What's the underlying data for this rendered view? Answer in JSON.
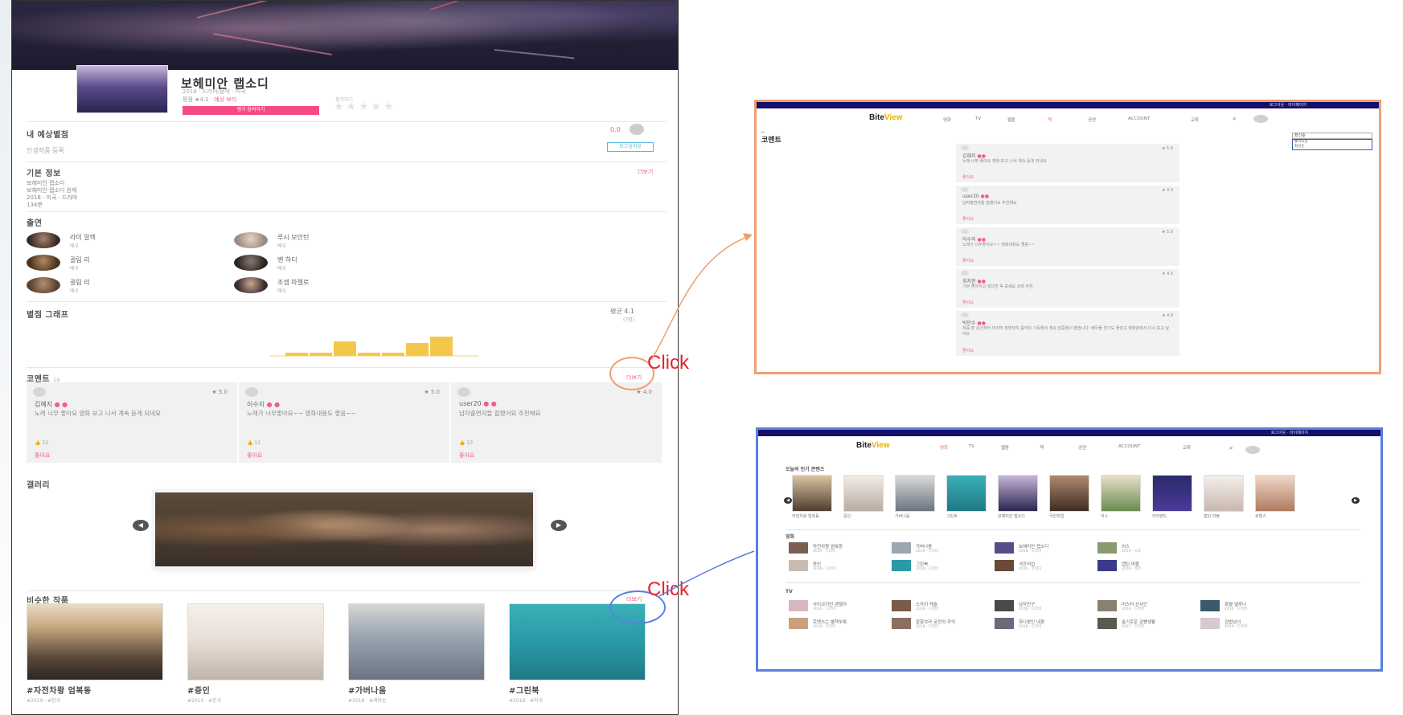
{
  "main": {
    "title": "보헤미안 랩소디",
    "subtitle": "2018 · 드라마/음악 · 미국",
    "rate_label": "평점",
    "rate_value": "★4.1",
    "rate_link": "예상 보러",
    "rate_button": "평가 참여하기",
    "stars_label": "평가하기",
    "stars": "★★★★★",
    "expect": {
      "title": "내 예상별점",
      "text": "인생작품 등록",
      "score": "0.0",
      "button": "보고싶어요"
    },
    "basic": {
      "title": "기본 정보",
      "more": "더보기",
      "lines": [
        "보헤미안 랩소디",
        "보헤미안 랩소디 원제",
        "2018 · 미국 · 드라마",
        "134분"
      ]
    },
    "cast": {
      "title": "출연",
      "people": [
        {
          "name": "라미 말렉",
          "role": "배우"
        },
        {
          "name": "루시 보인턴",
          "role": "배우"
        },
        {
          "name": "귈림 리",
          "role": "배우"
        },
        {
          "name": "벤 하디",
          "role": "배우"
        },
        {
          "name": "귈림 리",
          "role": "배우"
        },
        {
          "name": "조셉 마젤로",
          "role": "배우"
        }
      ]
    },
    "graph": {
      "title": "별점 그래프",
      "avg": "평균 4.1",
      "count": "(7명)"
    },
    "comments": {
      "title": "코멘트",
      "count": "19",
      "more": "더보기",
      "items": [
        {
          "user": "김혜지",
          "score": "5.0",
          "text": "노래 너무 좋아요 영화 보고 나서 계속 듣게 되네요",
          "likes": "12",
          "like_label": "좋아요"
        },
        {
          "user": "이수지",
          "score": "5.0",
          "text": "노래가 너무좋아요~~ 영화내용도 좋음~~",
          "likes": "11",
          "like_label": "좋아요"
        },
        {
          "user": "user20",
          "score": "4.0",
          "text": "남자출연자들 잘했어요 추천해요",
          "likes": "13",
          "like_label": "좋아요"
        }
      ]
    },
    "gallery": {
      "title": "갤러리"
    },
    "recommend": {
      "title": "비슷한 작품",
      "more": "더보기",
      "items": [
        {
          "title": "#자전차왕 엄복동",
          "sub": "#2019 · #한국"
        },
        {
          "title": "#증인",
          "sub": "#2019 · #한국"
        },
        {
          "title": "#가버나움",
          "sub": "#2018 · #레바논"
        },
        {
          "title": "#그린북",
          "sub": "#2018 · #미국"
        }
      ]
    }
  },
  "annotation": {
    "click_1": "Click",
    "click_2": "Click"
  },
  "shot_comments": {
    "topbar": "로그아웃 · 마이페이지",
    "logo_a": "B",
    "logo_b": "ite",
    "logo_c": "View",
    "nav": [
      "영화",
      "TV",
      "웹툰",
      "책",
      "공연",
      "ACCOUNT",
      "교류"
    ],
    "nav_active_index": 3,
    "title": "코멘트",
    "filter": "최신순",
    "filter_options": [
      "좋아요순",
      "최신순"
    ],
    "cards": [
      {
        "user": "김혜지",
        "score": "★ 5.0",
        "text": "노래 너무 좋아요 영화 보고 나서 계속 듣게 되네요",
        "like": "좋아요"
      },
      {
        "user": "user20",
        "score": "★ 4.0",
        "text": "남자출연자들 잘했어요 추천해요",
        "like": "좋아요"
      },
      {
        "user": "이수지",
        "score": "★ 5.0",
        "text": "노래가 너무좋아요~~ 영화내용도 좋음~~",
        "like": "좋아요"
      },
      {
        "user": "최지현",
        "score": "★ 4.5",
        "text": "기분 좋아지고 싶다면 꼭 보세요 강력 추천",
        "like": "좋아요"
      },
      {
        "user": "박민수",
        "score": "★ 4.0",
        "text": "처음 본 순간부터 마지막 장면까지 음악이 가득해서 계속 집중해서 봤습니다. 배우들 연기도 좋았고 영화관에서 다시 보고 싶어요",
        "like": "좋아요"
      }
    ]
  },
  "shot_home": {
    "topbar": "로그아웃 · 마이페이지",
    "logo_a": "B",
    "logo_b": "ite",
    "logo_c": "View",
    "nav": [
      "영화",
      "TV",
      "웹툰",
      "책",
      "공연",
      "ACCOUNT",
      "교류"
    ],
    "nav_active_index": 0,
    "section_top": "오늘의 인기 콘텐츠",
    "posters": [
      "자전차왕 엄복동",
      "증인",
      "가버나움",
      "그린북",
      "보헤미안 랩소디",
      "극한직업",
      "어스",
      "라라랜드",
      "캡틴 마블",
      "로맨스"
    ],
    "movie_label": "영화",
    "movie_rows": [
      [
        "자전차왕 엄복동",
        "가버나움",
        "보헤미안 랩소디",
        "어스"
      ],
      [
        "증인",
        "그린북",
        "극한직업",
        "캡틴 마블"
      ]
    ],
    "tv_label": "TV",
    "tv_rows": [
      [
        "사이코지만 괜찮아",
        "스카이 캐슬",
        "남자친구",
        "미스터 선샤인",
        "호텔 델루나"
      ],
      [
        "로맨스는 별책부록",
        "알함브라 궁전의 추억",
        "하나뿐인 내편",
        "슬기로운 감빵생활",
        "검법남녀"
      ]
    ]
  }
}
